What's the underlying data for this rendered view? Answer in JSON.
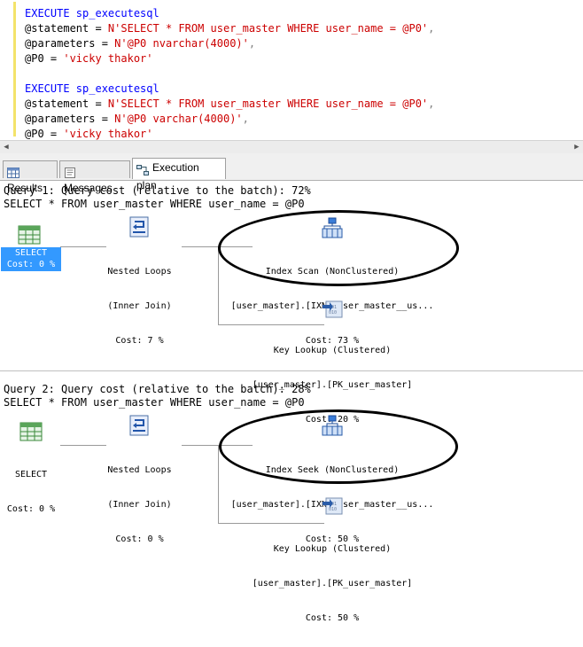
{
  "editor": {
    "lines": [
      {
        "kw": "EXECUTE",
        "rest": " sp_executesql"
      },
      {
        "pre": "@statement = ",
        "str": "N'SELECT * FROM user_master WHERE user_name = @P0'",
        "post": ","
      },
      {
        "pre": "@parameters = ",
        "str": "N'@P0 nvarchar(4000)'",
        "post": ","
      },
      {
        "pre": "@P0 = ",
        "str": "'vicky thakor'",
        "post": ""
      },
      {
        "kw": "EXECUTE",
        "rest": " sp_executesql"
      },
      {
        "pre": "@statement = ",
        "str": "N'SELECT * FROM user_master WHERE user_name = @P0'",
        "post": ","
      },
      {
        "pre": "@parameters = ",
        "str": "N'@P0 varchar(4000)'",
        "post": ","
      },
      {
        "pre": "@P0 = ",
        "str": "'vicky thakor'",
        "post": ""
      }
    ]
  },
  "tabs": [
    {
      "label": "Results",
      "icon": "grid-icon"
    },
    {
      "label": "Messages",
      "icon": "messages-icon"
    },
    {
      "label": "Execution plan",
      "icon": "execution-plan-icon"
    }
  ],
  "query1": {
    "header": "Query 1: Query cost (relative to the batch): 72%",
    "sql": "SELECT * FROM user_master WHERE user_name = @P0",
    "select": {
      "l1": "SELECT",
      "l2": "Cost: 0 %"
    },
    "loops": {
      "l1": "Nested Loops",
      "l2": "(Inner Join)",
      "l3": "Cost: 7 %"
    },
    "scan": {
      "l1": "Index Scan (NonClustered)",
      "l2": "[user_master].[IXNc_user_master__us...",
      "l3": "Cost: 73 %"
    },
    "lookup": {
      "l1": "Key Lookup (Clustered)",
      "l2": "[user_master].[PK_user_master]",
      "l3": "Cost: 20 %"
    }
  },
  "query2": {
    "header": "Query 2: Query cost (relative to the batch): 28%",
    "sql": "SELECT * FROM user_master WHERE user_name = @P0",
    "select": {
      "l1": "SELECT",
      "l2": "Cost: 0 %"
    },
    "loops": {
      "l1": "Nested Loops",
      "l2": "(Inner Join)",
      "l3": "Cost: 0 %"
    },
    "seek": {
      "l1": "Index Seek (NonClustered)",
      "l2": "[user_master].[IXNc_user_master__us...",
      "l3": "Cost: 50 %"
    },
    "lookup": {
      "l1": "Key Lookup (Clustered)",
      "l2": "[user_master].[PK_user_master]",
      "l3": "Cost: 50 %"
    }
  },
  "colors": {
    "keyword": "#0000ff",
    "string": "#cc0000",
    "selected": "#3399ff",
    "gutter_mark": "#f3e36a"
  }
}
